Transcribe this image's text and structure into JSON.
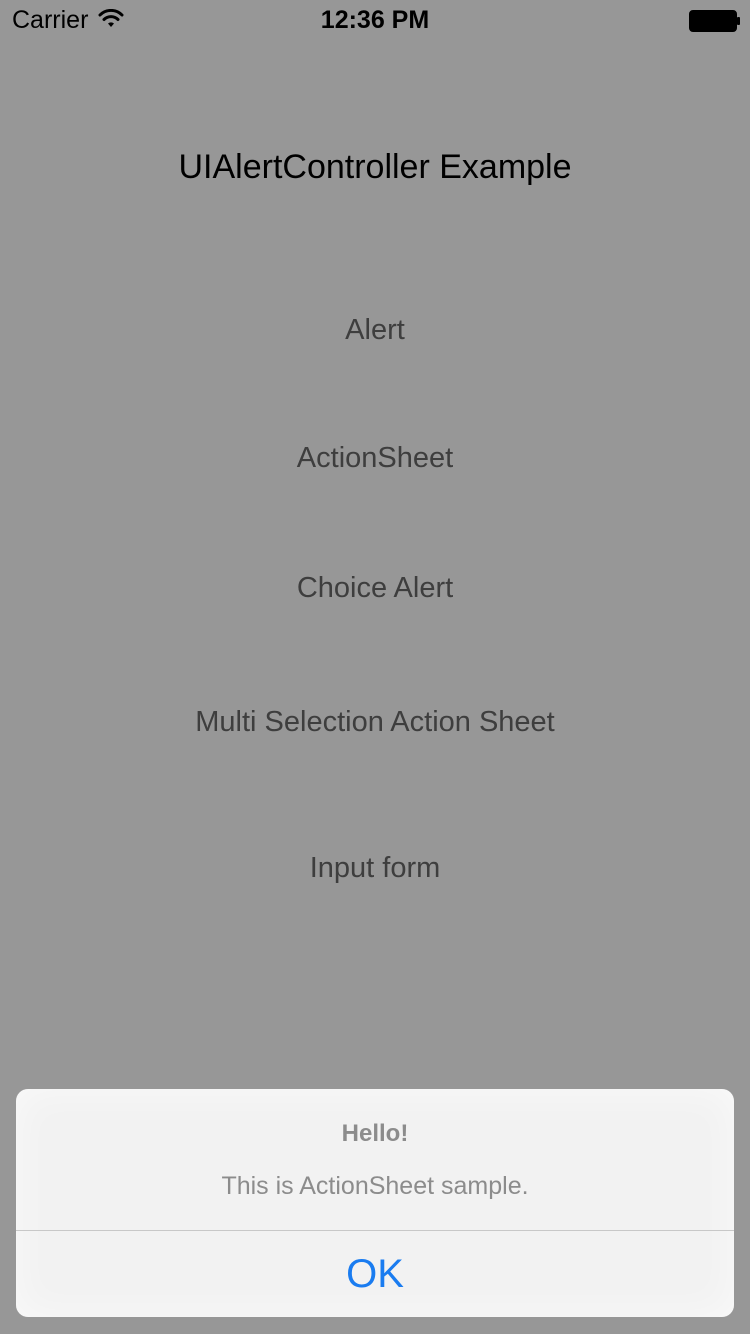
{
  "status_bar": {
    "carrier": "Carrier",
    "time": "12:36 PM",
    "wifi_icon": "wifi-icon",
    "battery_icon": "battery-icon"
  },
  "main": {
    "title": "UIAlertController Example",
    "buttons": [
      {
        "label": "Alert"
      },
      {
        "label": "ActionSheet"
      },
      {
        "label": "Choice Alert"
      },
      {
        "label": "Multi Selection Action Sheet"
      },
      {
        "label": "Input form"
      }
    ]
  },
  "action_sheet": {
    "title": "Hello!",
    "message": "This is ActionSheet sample.",
    "ok_label": "OK"
  },
  "colors": {
    "background_dim": "#979797",
    "sheet_background": "#f2f2f2",
    "accent": "#1a7cf0",
    "muted_text": "#8c8c8c"
  }
}
